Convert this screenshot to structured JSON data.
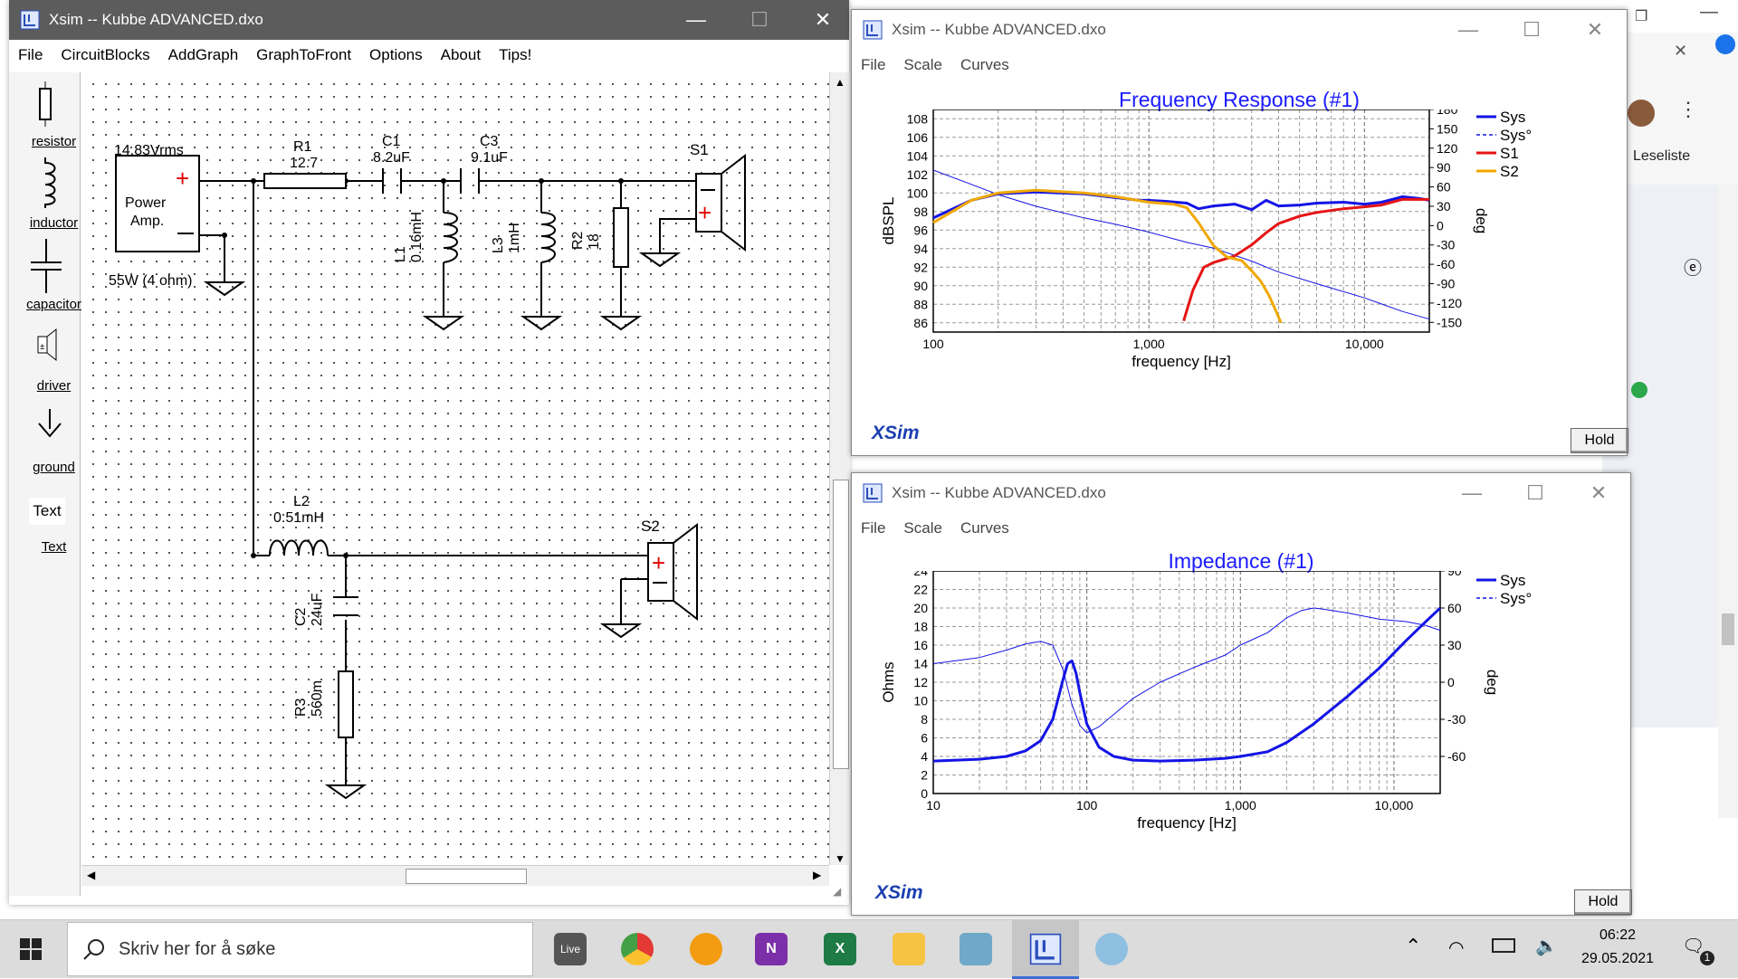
{
  "main_window": {
    "title": "Xsim -- Kubbe ADVANCED.dxo",
    "menu": [
      "File",
      "CircuitBlocks",
      "AddGraph",
      "GraphToFront",
      "Options",
      "About",
      "Tips!"
    ]
  },
  "tools": [
    {
      "label": "resistor",
      "icon": "resistor-icon"
    },
    {
      "label": "inductor",
      "icon": "inductor-icon"
    },
    {
      "label": "capacitor",
      "icon": "capacitor-icon"
    },
    {
      "label": "driver",
      "icon": "driver-icon"
    },
    {
      "label": "ground",
      "icon": "ground-icon"
    },
    {
      "label": "Text",
      "icon": "text-tool-icon",
      "glyph": "Text"
    }
  ],
  "schematic": {
    "amp_voltage": "14.83Vrms",
    "amp_label1": "Power",
    "amp_label2": "Amp.",
    "amp_rating": "55W (4 ohm)",
    "r1_name": "R1",
    "r1_value": "12.7",
    "c1_name": "C1",
    "c1_value": "8.2uF",
    "c3_name": "C3",
    "c3_value": "9.1uF",
    "s1_name": "S1",
    "l1_name": "L1",
    "l1_value": "0.16mH",
    "l3_name": "L3",
    "l3_value": "1mH",
    "r2_name": "R2",
    "r2_value": "18",
    "l2_name": "L2",
    "l2_value": "0.51mH",
    "s2_name": "S2",
    "c2_name": "C2",
    "c2_value": "24uF",
    "r3_name": "R3",
    "r3_value": "560m"
  },
  "freq_window": {
    "title": "Xsim -- Kubbe ADVANCED.dxo",
    "menu": [
      "File",
      "Scale",
      "Curves"
    ],
    "logo": "XSim",
    "hold": "Hold"
  },
  "imp_window": {
    "title": "Xsim -- Kubbe ADVANCED.dxo",
    "menu": [
      "File",
      "Scale",
      "Curves"
    ],
    "logo": "XSim",
    "hold": "Hold"
  },
  "chart_data": [
    {
      "type": "line",
      "title": "Frequency Response (#1)",
      "xlabel": "frequency [Hz]",
      "ylabel": "dBSPL",
      "y2label": "deg",
      "xscale": "log",
      "xlim": [
        100,
        20000
      ],
      "ylim": [
        85,
        109
      ],
      "y2lim": [
        -165,
        180
      ],
      "xticks": [
        "100",
        "1,000",
        "10,000"
      ],
      "yticks": [
        "86",
        "88",
        "90",
        "92",
        "94",
        "96",
        "98",
        "100",
        "102",
        "104",
        "106",
        "108"
      ],
      "y2ticks": [
        "-150",
        "-120",
        "-90",
        "-60",
        "-30",
        "0",
        "30",
        "60",
        "90",
        "120",
        "150",
        "180"
      ],
      "grid": true,
      "legend_position": "right",
      "series": [
        {
          "name": "Sys",
          "color": "#1414e6",
          "style": "solid",
          "width": 3,
          "axis": "left",
          "x": [
            100,
            150,
            200,
            300,
            500,
            700,
            900,
            1000,
            1200,
            1500,
            1700,
            2000,
            2500,
            3000,
            3500,
            4000,
            5000,
            6000,
            8000,
            10000,
            12000,
            15000,
            18000,
            20000
          ],
          "y": [
            97.3,
            99.2,
            99.9,
            100.1,
            99.9,
            99.5,
            99.2,
            99.2,
            99.1,
            98.9,
            98.3,
            98.6,
            98.8,
            98.2,
            99.2,
            98.6,
            98.7,
            98.9,
            99.0,
            98.8,
            99.0,
            99.6,
            99.4,
            99.2
          ]
        },
        {
          "name": "Sys°",
          "color": "#1414e6",
          "style": "dashed",
          "width": 1,
          "axis": "right",
          "x": [
            100,
            150,
            200,
            300,
            500,
            700,
            1000,
            1500,
            2000,
            3000,
            4000,
            6000,
            10000,
            15000,
            20000
          ],
          "y": [
            86,
            64,
            48,
            30,
            12,
            2,
            -10,
            -26,
            -35,
            -55,
            -72,
            -90,
            -112,
            -133,
            -145
          ]
        },
        {
          "name": "S1",
          "color": "#e61414",
          "style": "solid",
          "width": 3,
          "axis": "left",
          "x": [
            1450,
            1600,
            1800,
            2000,
            2200,
            2500,
            3000,
            3500,
            4000,
            5000,
            6000,
            8000,
            10000,
            12000,
            15000,
            18000,
            20000
          ],
          "y": [
            86.2,
            89.5,
            92.0,
            92.5,
            92.8,
            93.2,
            94.4,
            95.7,
            96.7,
            97.5,
            97.9,
            98.3,
            98.5,
            98.7,
            99.3,
            99.3,
            99.3
          ]
        },
        {
          "name": "S2",
          "color": "#f0a800",
          "style": "solid",
          "width": 3,
          "axis": "left",
          "x": [
            100,
            150,
            200,
            300,
            500,
            700,
            1000,
            1300,
            1500,
            1700,
            2000,
            2300,
            2700,
            3000,
            3300,
            3600,
            3900,
            4100
          ],
          "y": [
            96.8,
            99.2,
            100.0,
            100.3,
            100.0,
            99.6,
            99.0,
            98.8,
            98.4,
            96.8,
            94.3,
            93.1,
            92.7,
            91.6,
            90.5,
            89.0,
            87.2,
            86.0
          ]
        }
      ]
    },
    {
      "type": "line",
      "title": "Impedance (#1)",
      "xlabel": "frequency [Hz]",
      "ylabel": "Ohms",
      "y2label": "deg",
      "xscale": "log",
      "xlim": [
        10,
        20000
      ],
      "ylim": [
        0,
        24
      ],
      "y2lim": [
        -90,
        90
      ],
      "xticks": [
        "10",
        "100",
        "1,000",
        "10,000"
      ],
      "yticks": [
        "0",
        "2",
        "4",
        "6",
        "8",
        "10",
        "12",
        "14",
        "16",
        "18",
        "20",
        "22",
        "24"
      ],
      "y2ticks": [
        "-60",
        "-30",
        "0",
        "30",
        "60",
        "90"
      ],
      "grid": true,
      "legend_position": "right",
      "series": [
        {
          "name": "Sys",
          "color": "#1414e6",
          "style": "solid",
          "width": 3,
          "axis": "left",
          "x": [
            10,
            20,
            30,
            40,
            50,
            60,
            70,
            75,
            80,
            85,
            90,
            100,
            120,
            150,
            200,
            300,
            500,
            800,
            1000,
            1500,
            2000,
            3000,
            5000,
            8000,
            12000,
            16000,
            20000
          ],
          "y": [
            3.5,
            3.7,
            4.0,
            4.6,
            5.7,
            8.0,
            12.3,
            14.0,
            14.3,
            13.0,
            10.9,
            7.5,
            5.0,
            4.0,
            3.6,
            3.5,
            3.6,
            3.8,
            4.0,
            4.5,
            5.5,
            7.5,
            10.5,
            13.5,
            16.5,
            18.5,
            20.0
          ]
        },
        {
          "name": "Sys°",
          "color": "#1414e6",
          "style": "dashed",
          "width": 1,
          "axis": "right",
          "x": [
            10,
            20,
            30,
            40,
            50,
            60,
            70,
            80,
            90,
            100,
            120,
            150,
            200,
            300,
            500,
            800,
            1000,
            1500,
            2000,
            2500,
            3000,
            3500,
            5000,
            8000,
            12000,
            16000,
            20000
          ],
          "y": [
            15,
            20,
            26,
            31,
            33,
            30,
            10,
            -18,
            -35,
            -41,
            -36,
            -26,
            -13,
            0,
            12,
            22,
            30,
            40,
            52,
            58,
            60,
            59,
            56,
            51,
            49,
            46,
            42
          ]
        }
      ]
    }
  ],
  "taskbar": {
    "search_placeholder": "Skriv her for å søke",
    "time": "06:22",
    "date": "29.05.2021",
    "live_label": "Live",
    "notification_count": "1"
  },
  "browser": {
    "reading_list": "Leseliste"
  }
}
